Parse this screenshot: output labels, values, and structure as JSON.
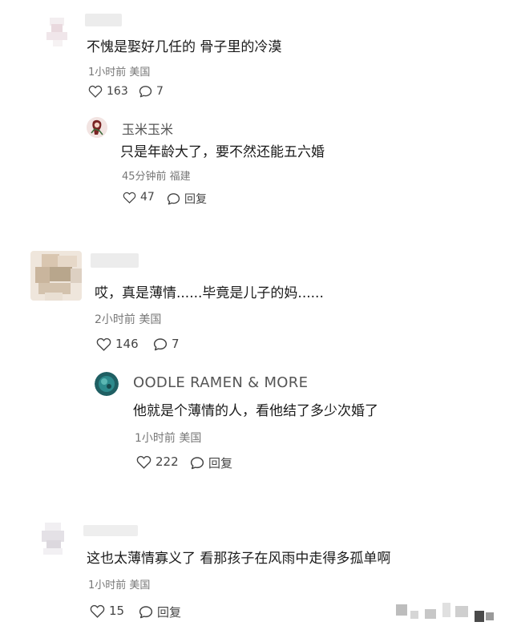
{
  "comments": [
    {
      "text": "不愧是娶好几任的 骨子里的冷漠",
      "meta": "1小时前 美国",
      "likes": "163",
      "replies_count": "7"
    },
    {
      "text": "哎，真是薄情......毕竟是儿子的妈......",
      "meta": "2小时前 美国",
      "likes": "146",
      "replies_count": "7"
    },
    {
      "text": "这也太薄情寡义了 看那孩子在风雨中走得多孤单啊",
      "meta": "1小时前 美国",
      "likes": "15",
      "reply_label": "回复"
    }
  ],
  "replies": [
    {
      "username": "玉米玉米",
      "text": "只是年龄大了，要不然还能五六婚",
      "meta": "45分钟前 福建",
      "likes": "47",
      "reply_label": "回复"
    },
    {
      "username": "OODLE RAMEN & MORE",
      "text": "他就是个薄情的人，看他结了多少次婚了",
      "meta": "1小时前 美国",
      "likes": "222",
      "reply_label": "回复"
    }
  ],
  "icons": {
    "heart": "heart-icon",
    "comment": "comment-bubble-icon"
  },
  "colors": {
    "text": "#1a1a1a",
    "meta": "#777777",
    "action": "#444444"
  }
}
